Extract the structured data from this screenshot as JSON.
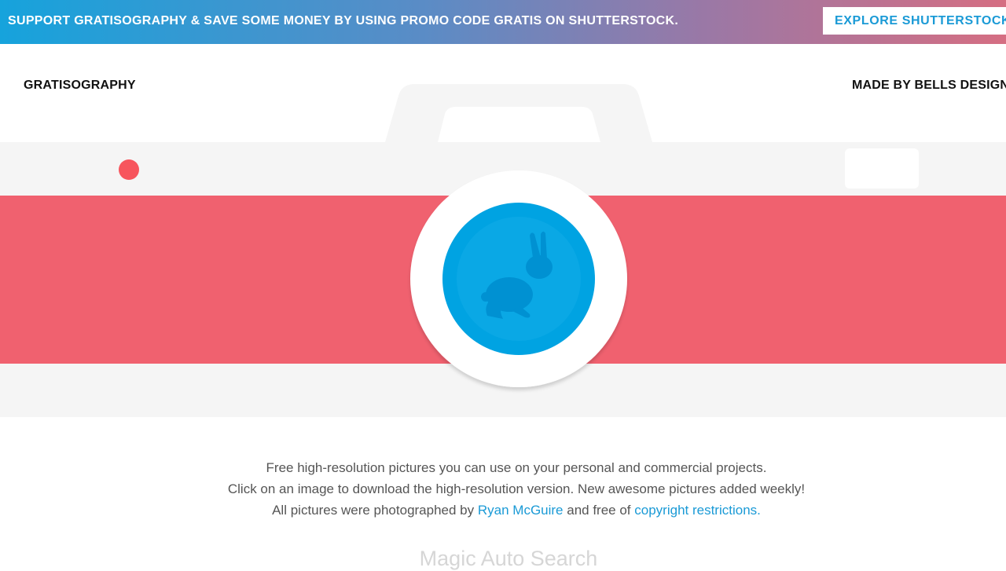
{
  "promo": {
    "text": "SUPPORT GRATISOGRAPHY & SAVE SOME MONEY BY USING PROMO CODE GRATIS ON SHUTTERSTOCK.",
    "button_label": "EXPLORE SHUTTERSTOCK"
  },
  "header": {
    "logo": "GRATISOGRAPHY",
    "credit": "MADE BY BELLS DESIGN"
  },
  "intro": {
    "line1": "Free high-resolution pictures you can use on your personal and commercial projects.",
    "line2": "Click on an image to download the high-resolution version. New awesome pictures added weekly!",
    "line3_prefix": "All pictures were photographed by",
    "photographer": "Ryan McGuire",
    "line3_middle": "and free of",
    "copyright_link": "copyright restrictions."
  },
  "search": {
    "title": "Magic Auto Search"
  },
  "colors": {
    "promo_gradient_start": "#16a3dc",
    "promo_gradient_end": "#d56e82",
    "camera_body": "#f5f5f5",
    "camera_stripe": "#f0616f",
    "lens_blue": "#00a3e2",
    "flash_dot": "#f7555d",
    "link": "#1a9ad6"
  },
  "icons": {
    "lens_emblem": "rabbit-icon"
  }
}
